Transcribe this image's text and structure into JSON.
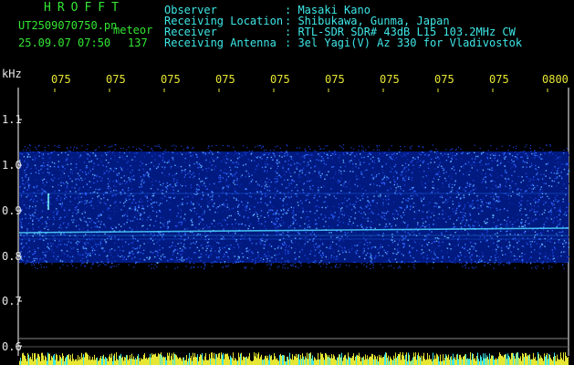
{
  "header": {
    "app_name": "HROFFT",
    "file_name": "UT2509070750.pn",
    "tag": "meteor",
    "date_time": "25.09.07 07:50",
    "count": "137"
  },
  "info": {
    "labels": [
      "Observer",
      "Receiving Location",
      "Receiver",
      "Receiving Antenna"
    ],
    "values": [
      ": Masaki Kano",
      ": Shibukawa, Gunma, Japan",
      ": RTL-SDR SDR# 43dB L15 103.2MHz CW",
      ": 3el Yagi(V) Az 330 for Vladivostok"
    ]
  },
  "axes": {
    "y_unit": "kHz",
    "y_ticks": [
      "1.1",
      "1.0",
      "0.9",
      "0.8",
      "0.7",
      "0.6"
    ],
    "x_ticks": [
      "075",
      "075",
      "075",
      "075",
      "075",
      "075",
      "075",
      "075",
      "075",
      "0800"
    ]
  },
  "colors": {
    "header_green": "#33e633",
    "info_cyan": "#3fe6e6",
    "time_yellow": "#e6e633",
    "background": "#000000",
    "noise_blue": "#1a3fd6"
  }
}
